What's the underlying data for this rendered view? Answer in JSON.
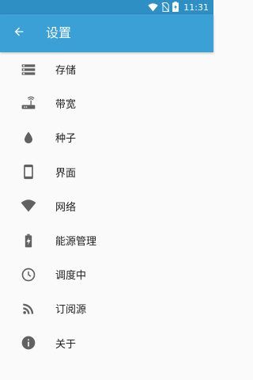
{
  "status_bar": {
    "time": "11:31",
    "icons": [
      "wifi-icon",
      "no-sim-icon",
      "battery-charging-icon"
    ]
  },
  "app_bar": {
    "title": "设置",
    "back_icon": "arrow-back-icon",
    "color": "#3aa0d6",
    "status_color": "#2e8fc4"
  },
  "settings": {
    "items": [
      {
        "label": "存储",
        "icon": "storage-icon"
      },
      {
        "label": "带宽",
        "icon": "router-icon"
      },
      {
        "label": "种子",
        "icon": "water-drop-icon"
      },
      {
        "label": "界面",
        "icon": "smartphone-icon"
      },
      {
        "label": "网络",
        "icon": "wifi-icon"
      },
      {
        "label": "能源管理",
        "icon": "battery-charging-icon"
      },
      {
        "label": "调度中",
        "icon": "clock-icon"
      },
      {
        "label": "订阅源",
        "icon": "rss-icon"
      },
      {
        "label": "关于",
        "icon": "info-icon"
      }
    ]
  }
}
